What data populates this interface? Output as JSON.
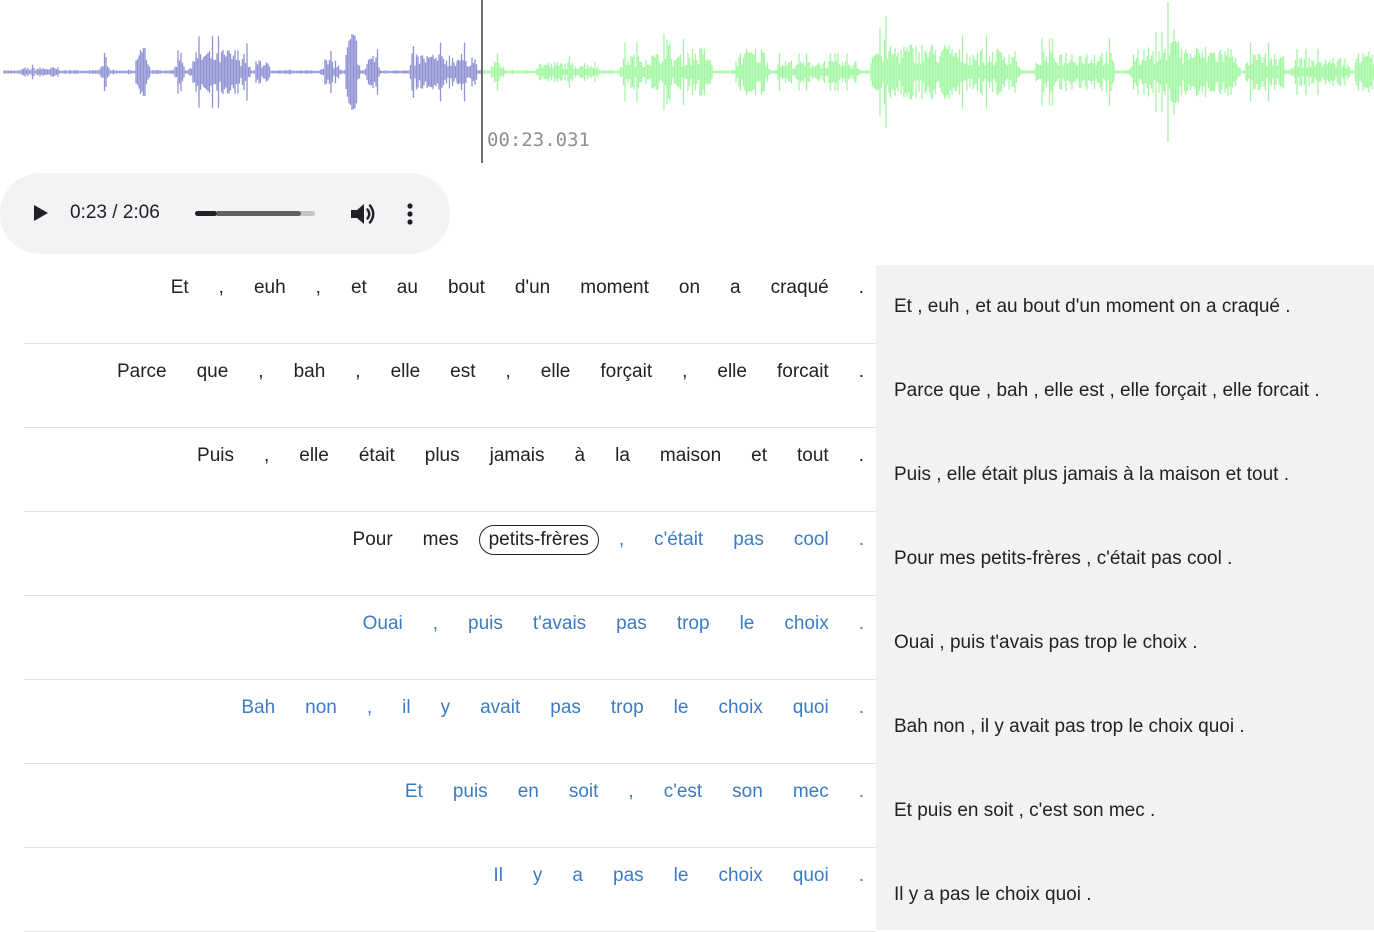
{
  "waveform": {
    "current_time_label": "00:23.031",
    "played_color": "#a8abdd",
    "played_peak_color": "#8f93d4",
    "unplayed_color": "#a3f7a3",
    "playhead_color": "#707070",
    "progress_fraction": 0.183
  },
  "player": {
    "time_display": "0:23 / 2:06",
    "progress_fraction": 0.183,
    "buffered_fraction": 0.88,
    "play_icon": "play-icon",
    "volume_icon": "volume-icon",
    "menu_icon": "more-vert-icon"
  },
  "rows": [
    {
      "tokens": [
        "Et",
        ",",
        "euh",
        ",",
        "et",
        "au",
        "bout",
        "d'un",
        "moment",
        "on",
        "a",
        "craqué",
        "."
      ],
      "sentence": "Et , euh , et au bout d'un moment on a craqué ."
    },
    {
      "tokens": [
        "Parce",
        "que",
        ",",
        "bah",
        ",",
        "elle",
        "est",
        ",",
        "elle",
        "forçait",
        ",",
        "elle",
        "forcait",
        "."
      ],
      "sentence": "Parce que , bah , elle est , elle forçait , elle forcait ."
    },
    {
      "tokens": [
        "Puis",
        ",",
        "elle",
        "était",
        "plus",
        "jamais",
        "à",
        "la",
        "maison",
        "et",
        "tout",
        "."
      ],
      "sentence": "Puis , elle était plus jamais à la maison et tout ."
    },
    {
      "tokens": [
        "Pour",
        "mes",
        "petits-frères",
        ",",
        "c'était",
        "pas",
        "cool",
        "."
      ],
      "sentence": "Pour mes petits-frères , c'était pas cool .",
      "current_index": 2
    },
    {
      "tokens": [
        "Ouai",
        ",",
        "puis",
        "t'avais",
        "pas",
        "trop",
        "le",
        "choix",
        "."
      ],
      "sentence": "Ouai , puis t'avais pas trop le choix ."
    },
    {
      "tokens": [
        "Bah",
        "non",
        ",",
        "il",
        "y",
        "avait",
        "pas",
        "trop",
        "le",
        "choix",
        "quoi",
        "."
      ],
      "sentence": "Bah non , il y avait pas trop le choix quoi ."
    },
    {
      "tokens": [
        "Et",
        "puis",
        "en",
        "soit",
        ",",
        "c'est",
        "son",
        "mec",
        "."
      ],
      "sentence": "Et puis en soit , c'est son mec ."
    },
    {
      "tokens": [
        "Il",
        "y",
        "a",
        "pas",
        "le",
        "choix",
        "quoi",
        "."
      ],
      "sentence": "Il y a pas le choix quoi ."
    }
  ],
  "colors": {
    "token_spoken": "#222222",
    "token_upcoming": "#3a7cc4",
    "sentence_panel_bg": "#f2f2f2",
    "player_bg": "#f1f3f4"
  }
}
